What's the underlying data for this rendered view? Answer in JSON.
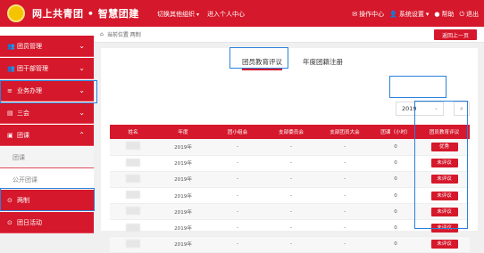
{
  "header": {
    "brand": "网上共青团 • 智慧团建",
    "switch_org": "切换其他组织",
    "personal_center": "进入个人中心",
    "right_items": [
      "操作中心",
      "系统设置",
      "帮助",
      "退出"
    ]
  },
  "sidebar": {
    "items": [
      {
        "label": "团员管理",
        "icon": "团"
      },
      {
        "label": "团干部管理",
        "icon": "团"
      },
      {
        "label": "业务办理",
        "icon": "≡"
      },
      {
        "label": "三会",
        "icon": "▤"
      },
      {
        "label": "团课",
        "icon": "▣"
      },
      {
        "label": "团课",
        "icon": ""
      },
      {
        "label": "公开团课",
        "icon": ""
      },
      {
        "label": "两制",
        "icon": "⊙"
      },
      {
        "label": "团日活动",
        "icon": "⊙"
      }
    ]
  },
  "breadcrumb": {
    "text": "当前位置 两制"
  },
  "back_button": "返回上一页",
  "tabs": [
    "团员教育评议",
    "年度团籍注册"
  ],
  "filter": {
    "year": "2019"
  },
  "table": {
    "headers": [
      "姓名",
      "年度",
      "团小组会",
      "支部委员会",
      "支部团员大会",
      "团课（小时）",
      "团员教育评议"
    ],
    "rows": [
      {
        "year": "2019年",
        "c1": "-",
        "c2": "-",
        "c3": "-",
        "hours": "0",
        "action": "优秀"
      },
      {
        "year": "2019年",
        "c1": "-",
        "c2": "-",
        "c3": "-",
        "hours": "0",
        "action": "未评议"
      },
      {
        "year": "2019年",
        "c1": "-",
        "c2": "-",
        "c3": "-",
        "hours": "0",
        "action": "未评议"
      },
      {
        "year": "2019年",
        "c1": "-",
        "c2": "-",
        "c3": "-",
        "hours": "0",
        "action": "未评议"
      },
      {
        "year": "2019年",
        "c1": "-",
        "c2": "-",
        "c3": "-",
        "hours": "0",
        "action": "未评议"
      },
      {
        "year": "2019年",
        "c1": "-",
        "c2": "-",
        "c3": "-",
        "hours": "0",
        "action": "未评议"
      },
      {
        "year": "2019年",
        "c1": "-",
        "c2": "-",
        "c3": "-",
        "hours": "0",
        "action": "未评议"
      }
    ]
  },
  "colors": {
    "brand": "#d5182b",
    "highlight": "#2a80dd"
  }
}
